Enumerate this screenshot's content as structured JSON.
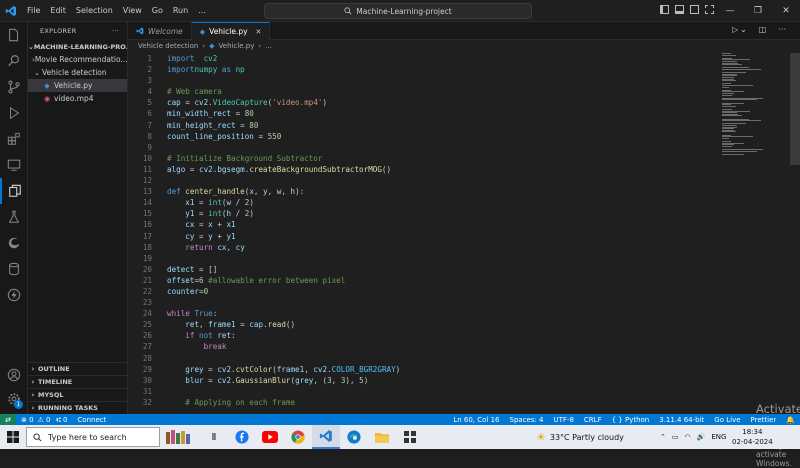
{
  "titlebar": {
    "menu": [
      "File",
      "Edit",
      "Selection",
      "View",
      "Go",
      "Run",
      "..."
    ],
    "command_center": "Machine-Learning-project"
  },
  "sidebar": {
    "header": "EXPLORER",
    "more": "···",
    "root": "MACHINE-LEARNING-PRO...",
    "items": [
      {
        "label": "Movie Recommendatio...",
        "type": "folder-collapsed"
      },
      {
        "label": "Vehicle detection",
        "type": "folder-expanded"
      },
      {
        "label": "Vehicle.py",
        "type": "python"
      },
      {
        "label": "video.mp4",
        "type": "video"
      }
    ],
    "sections": [
      "OUTLINE",
      "TIMELINE",
      "MYSQL",
      "RUNNING TASKS"
    ]
  },
  "activity_badge": "1",
  "tabs": [
    {
      "label": "Welcome",
      "active": false
    },
    {
      "label": "Vehicle.py",
      "active": true
    }
  ],
  "breadcrumb": [
    "Vehicle detection",
    "Vehicle.py",
    "..."
  ],
  "code_lines": [
    {
      "n": "1",
      "tokens": [
        [
          "kw",
          "import"
        ],
        [
          "",
          "  "
        ],
        [
          "cls",
          "cv2"
        ]
      ]
    },
    {
      "n": "2",
      "tokens": [
        [
          "kw",
          "import"
        ],
        [
          "",
          ""
        ],
        [
          "cls",
          "numpy"
        ],
        [
          "",
          " "
        ],
        [
          "kw",
          "as"
        ],
        [
          "",
          " "
        ],
        [
          "cls",
          "np"
        ]
      ]
    },
    {
      "n": "3",
      "tokens": []
    },
    {
      "n": "4",
      "tokens": [
        [
          "cm",
          "# Web camera"
        ]
      ]
    },
    {
      "n": "5",
      "tokens": [
        [
          "var",
          "cap"
        ],
        [
          "",
          " = "
        ],
        [
          "var",
          "cv2"
        ],
        [
          "",
          "."
        ],
        [
          "cls",
          "VideoCapture"
        ],
        [
          "",
          "("
        ],
        [
          "str",
          "'video.mp4'"
        ],
        [
          "",
          ")"
        ]
      ]
    },
    {
      "n": "6",
      "tokens": [
        [
          "var",
          "min_width_rect"
        ],
        [
          "",
          " = "
        ],
        [
          "num",
          "80"
        ]
      ]
    },
    {
      "n": "7",
      "tokens": [
        [
          "var",
          "min_height_rect"
        ],
        [
          "",
          " = "
        ],
        [
          "num",
          "80"
        ]
      ]
    },
    {
      "n": "8",
      "tokens": [
        [
          "var",
          "count_line_position"
        ],
        [
          "",
          " = "
        ],
        [
          "num",
          "550"
        ]
      ]
    },
    {
      "n": "9",
      "tokens": []
    },
    {
      "n": "10",
      "tokens": [
        [
          "cm",
          "# Initialize Background Subtractor"
        ]
      ]
    },
    {
      "n": "11",
      "tokens": [
        [
          "var",
          "algo"
        ],
        [
          "",
          " = "
        ],
        [
          "var",
          "cv2"
        ],
        [
          "",
          "."
        ],
        [
          "var",
          "bgsegm"
        ],
        [
          "",
          "."
        ],
        [
          "fn",
          "createBackgroundSubtractorMOG"
        ],
        [
          "",
          "()"
        ]
      ]
    },
    {
      "n": "12",
      "tokens": []
    },
    {
      "n": "13",
      "tokens": [
        [
          "kw",
          "def"
        ],
        [
          "",
          " "
        ],
        [
          "fn",
          "center_handle"
        ],
        [
          "",
          "("
        ],
        [
          "var",
          "x"
        ],
        [
          "",
          ", "
        ],
        [
          "var",
          "y"
        ],
        [
          "",
          ", "
        ],
        [
          "var",
          "w"
        ],
        [
          "",
          ", "
        ],
        [
          "var",
          "h"
        ],
        [
          "",
          "):"
        ]
      ]
    },
    {
      "n": "14",
      "tokens": [
        [
          "",
          "    "
        ],
        [
          "var",
          "x1"
        ],
        [
          "",
          " = "
        ],
        [
          "cls",
          "int"
        ],
        [
          "",
          "("
        ],
        [
          "var",
          "w"
        ],
        [
          "",
          " / "
        ],
        [
          "num",
          "2"
        ],
        [
          "",
          ")"
        ]
      ]
    },
    {
      "n": "15",
      "tokens": [
        [
          "",
          "    "
        ],
        [
          "var",
          "y1"
        ],
        [
          "",
          " = "
        ],
        [
          "cls",
          "int"
        ],
        [
          "",
          "("
        ],
        [
          "var",
          "h"
        ],
        [
          "",
          " / "
        ],
        [
          "num",
          "2"
        ],
        [
          "",
          ")"
        ]
      ]
    },
    {
      "n": "16",
      "tokens": [
        [
          "",
          "    "
        ],
        [
          "var",
          "cx"
        ],
        [
          "",
          " = "
        ],
        [
          "var",
          "x"
        ],
        [
          "",
          " + "
        ],
        [
          "var",
          "x1"
        ]
      ]
    },
    {
      "n": "17",
      "tokens": [
        [
          "",
          "    "
        ],
        [
          "var",
          "cy"
        ],
        [
          "",
          " = "
        ],
        [
          "var",
          "y"
        ],
        [
          "",
          " + "
        ],
        [
          "var",
          "y1"
        ]
      ]
    },
    {
      "n": "18",
      "tokens": [
        [
          "",
          "    "
        ],
        [
          "ctl",
          "return"
        ],
        [
          "",
          " "
        ],
        [
          "var",
          "cx"
        ],
        [
          "",
          ", "
        ],
        [
          "var",
          "cy"
        ]
      ]
    },
    {
      "n": "19",
      "tokens": []
    },
    {
      "n": "20",
      "tokens": [
        [
          "var",
          "detect"
        ],
        [
          "",
          " = []"
        ]
      ]
    },
    {
      "n": "21",
      "tokens": [
        [
          "var",
          "offset"
        ],
        [
          "",
          "="
        ],
        [
          "num",
          "6"
        ],
        [
          "",
          " "
        ],
        [
          "cm",
          "#allowable error between pixel"
        ]
      ]
    },
    {
      "n": "22",
      "tokens": [
        [
          "var",
          "counter"
        ],
        [
          "",
          "="
        ],
        [
          "num",
          "0"
        ]
      ]
    },
    {
      "n": "23",
      "tokens": []
    },
    {
      "n": "24",
      "tokens": [
        [
          "ctl",
          "while"
        ],
        [
          "",
          " "
        ],
        [
          "kw",
          "True"
        ],
        [
          "",
          ":"
        ]
      ]
    },
    {
      "n": "25",
      "tokens": [
        [
          "",
          "    "
        ],
        [
          "var",
          "ret"
        ],
        [
          "",
          ", "
        ],
        [
          "var",
          "frame1"
        ],
        [
          "",
          " = "
        ],
        [
          "var",
          "cap"
        ],
        [
          "",
          "."
        ],
        [
          "fn",
          "read"
        ],
        [
          "",
          "()"
        ]
      ]
    },
    {
      "n": "26",
      "tokens": [
        [
          "",
          "    "
        ],
        [
          "ctl",
          "if"
        ],
        [
          "",
          " "
        ],
        [
          "kw",
          "not"
        ],
        [
          "",
          " "
        ],
        [
          "var",
          "ret"
        ],
        [
          "",
          ":"
        ]
      ]
    },
    {
      "n": "27",
      "tokens": [
        [
          "",
          "        "
        ],
        [
          "ctl",
          "break"
        ]
      ]
    },
    {
      "n": "28",
      "tokens": []
    },
    {
      "n": "29",
      "tokens": [
        [
          "",
          "    "
        ],
        [
          "var",
          "grey"
        ],
        [
          "",
          " = "
        ],
        [
          "var",
          "cv2"
        ],
        [
          "",
          "."
        ],
        [
          "fn",
          "cvtColor"
        ],
        [
          "",
          "("
        ],
        [
          "var",
          "frame1"
        ],
        [
          "",
          ", "
        ],
        [
          "var",
          "cv2"
        ],
        [
          "",
          "."
        ],
        [
          "const",
          "COLOR_BGR2GRAY"
        ],
        [
          "",
          ")"
        ]
      ]
    },
    {
      "n": "30",
      "tokens": [
        [
          "",
          "    "
        ],
        [
          "var",
          "blur"
        ],
        [
          "",
          " = "
        ],
        [
          "var",
          "cv2"
        ],
        [
          "",
          "."
        ],
        [
          "fn",
          "GaussianBlur"
        ],
        [
          "",
          "("
        ],
        [
          "var",
          "grey"
        ],
        [
          "",
          ", ("
        ],
        [
          "num",
          "3"
        ],
        [
          "",
          ", "
        ],
        [
          "num",
          "3"
        ],
        [
          "",
          "), "
        ],
        [
          "num",
          "5"
        ],
        [
          "",
          ")"
        ]
      ]
    },
    {
      "n": "31",
      "tokens": []
    },
    {
      "n": "32",
      "tokens": [
        [
          "",
          "    "
        ],
        [
          "cm",
          "# Applying on each frame"
        ]
      ]
    }
  ],
  "watermark": {
    "title": "Activate Windows",
    "subtitle": "Go to Settings to activate Windows."
  },
  "statusbar": {
    "left": [
      "⊗ 0",
      "⚠ 0",
      "⑆ 0",
      "Connect"
    ],
    "right": [
      "Ln 60, Col 16",
      "Spaces: 4",
      "UTF-8",
      "CRLF",
      "{ } Python",
      "3.11.4 64-bit",
      "Go Live",
      "Prettier"
    ]
  },
  "taskbar": {
    "search_placeholder": "Type here to search",
    "weather": "33°C  Partly cloudy",
    "lang": "ENG",
    "time": "18:34",
    "date": "02-04-2024"
  }
}
